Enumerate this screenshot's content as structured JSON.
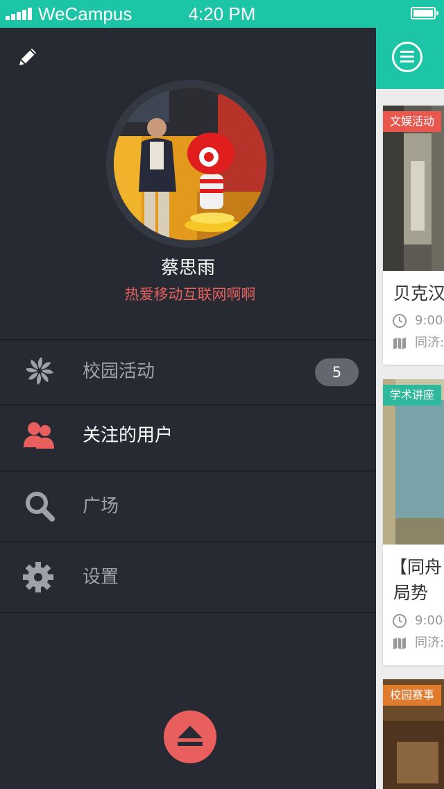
{
  "status_bar": {
    "carrier": "WeCampus",
    "time": "4:20 PM"
  },
  "profile": {
    "name": "蔡思雨",
    "motto": "热爱移动互联网啊啊"
  },
  "menu": {
    "items": [
      {
        "label": "校园活动",
        "icon": "pinwheel-icon",
        "badge": "5",
        "active": false
      },
      {
        "label": "关注的用户",
        "icon": "users-icon",
        "active": true
      },
      {
        "label": "广场",
        "icon": "search-icon",
        "active": false
      },
      {
        "label": "设置",
        "icon": "gear-icon",
        "active": false
      }
    ]
  },
  "feed": {
    "cards": [
      {
        "tag": "文娱活动",
        "tag_color": "#e8584f",
        "title_lines": [
          "贝克汉"
        ],
        "time": "9:00-",
        "location": "同济:"
      },
      {
        "tag": "学术讲座",
        "tag_color": "#2fb89b",
        "title_lines": [
          "【同舟",
          "局势"
        ],
        "time": "9:00-",
        "location": "同济:"
      },
      {
        "tag": "校园赛事",
        "tag_color": "#e07a2c"
      }
    ]
  },
  "colors": {
    "accent": "#1dc5a7",
    "sidebar_bg": "#272a33",
    "highlight_red": "#e85f5d",
    "badge_bg": "#636770"
  }
}
